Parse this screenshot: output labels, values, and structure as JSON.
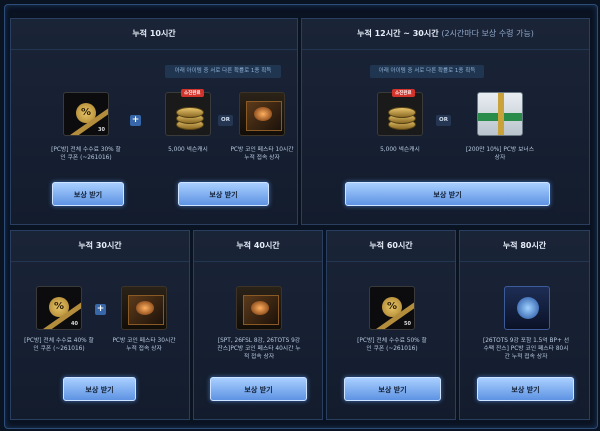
{
  "panels": {
    "p10": {
      "title": "누적 10시간",
      "notice": "아래 아이템 중 서로 다른 확률로 1종 획득",
      "coupon_text": "[PC방] 전체 수수료 30% 할인 쿠폰 (~261016)",
      "coupon_num": "30",
      "nexon_cash": "5,000 넥슨캐시",
      "nexon_tag": "소진완료",
      "box_text": "PC방 코인 페스타 10시간 누적 접속 상자",
      "button": "보상 받기"
    },
    "p12": {
      "title": "누적 12시간 ~ 30시간",
      "subtitle": "(2시간마다 보상 수령 가능)",
      "notice": "아래 아이템 중 서로 다른 확률로 1종 획득",
      "nexon_cash": "5,000 넥슨캐시",
      "nexon_tag": "소진완료",
      "box_text": "[200만 10%] PC방 보너스 상자",
      "button": "보상 받기"
    },
    "p30": {
      "title": "누적 30시간",
      "coupon_text": "[PC방] 전체 수수료 40% 할인 쿠폰 (~261016)",
      "coupon_num": "40",
      "box_text": "PC방 코인 페스타 30시간 누적 접속 상자",
      "button": "보상 받기"
    },
    "p40": {
      "title": "누적 40시간",
      "box_text": "[SPT, 26FSL 8강, 26TOTS 9강 잔스]PC방 코인 페스타 40시간 누적 접속 상자",
      "button": "보상 받기"
    },
    "p60": {
      "title": "누적 60시간",
      "coupon_text": "[PC방] 전체 수수료 50% 할인 쿠폰 (~261016)",
      "coupon_num": "50",
      "button": "보상 받기"
    },
    "p80": {
      "title": "누적 80시간",
      "box_text": "[26TOTS 9강 포함 1.5억 BP+ 선수팩 잔스] PC방 코인 페스타 80시간 누적 접속 상자",
      "button": "보상 받기"
    }
  },
  "icons": {
    "plus": "+",
    "or": "OR",
    "percent": "%"
  }
}
